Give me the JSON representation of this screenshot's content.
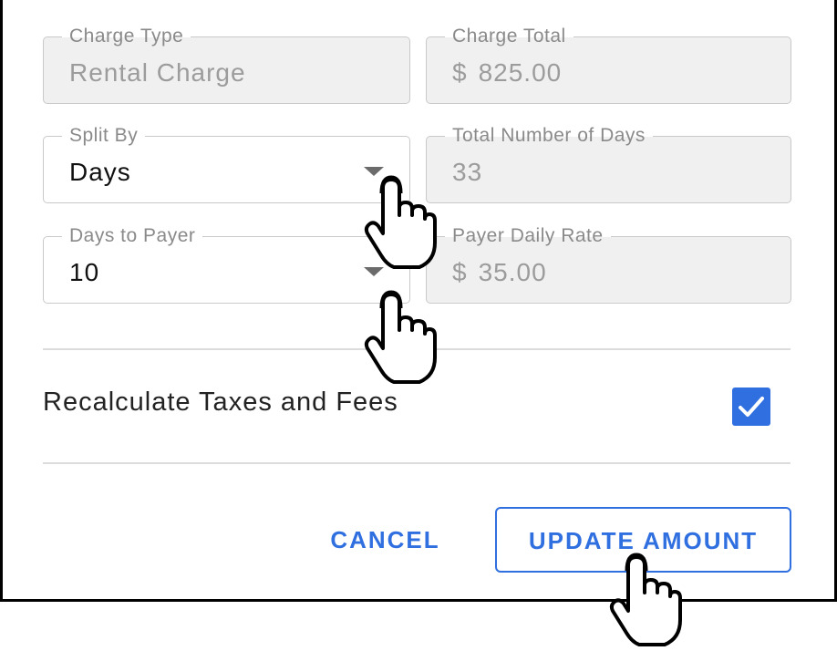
{
  "form": {
    "charge_type": {
      "label": "Charge Type",
      "value": "Rental Charge"
    },
    "charge_total": {
      "label": "Charge Total",
      "currency": "$",
      "value": "825.00"
    },
    "split_by": {
      "label": "Split By",
      "value": "Days"
    },
    "total_days": {
      "label": "Total Number of Days",
      "value": "33"
    },
    "days_to_payer": {
      "label": "Days to Payer",
      "value": "10"
    },
    "payer_daily_rate": {
      "label": "Payer Daily Rate",
      "currency": "$",
      "value": "35.00"
    }
  },
  "recalculate": {
    "label": "Recalculate Taxes and Fees",
    "checked": true
  },
  "actions": {
    "cancel_label": "CANCEL",
    "update_label": "UPDATE AMOUNT"
  },
  "colors": {
    "accent": "#2f6fe0",
    "disabled_bg": "#f0f0f0",
    "border": "#c9c9c9"
  },
  "icons": [
    "chevron-down-icon",
    "checkmark-icon",
    "hand-pointer-icon"
  ]
}
